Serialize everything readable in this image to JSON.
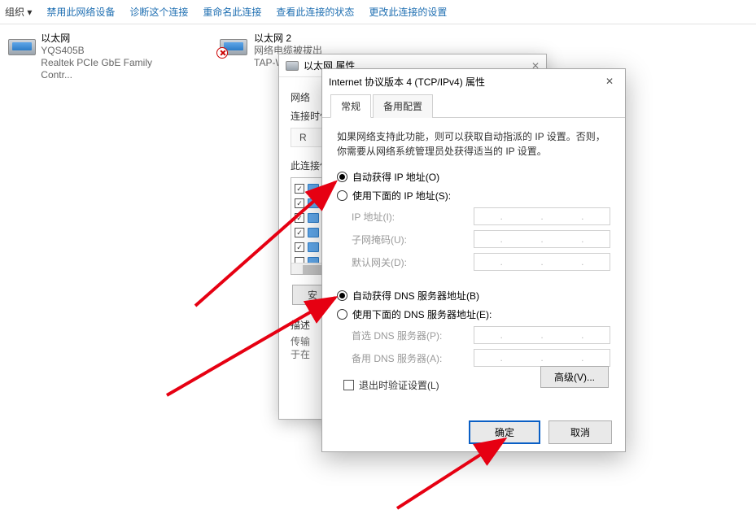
{
  "toolbar": {
    "label": "组织 ▾",
    "items": [
      "禁用此网络设备",
      "诊断这个连接",
      "重命名此连接",
      "查看此连接的状态",
      "更改此连接的设置"
    ]
  },
  "adapters": [
    {
      "name": "以太网",
      "line2": "YQS405B",
      "line3": "Realtek PCIe GbE Family Contr..."
    },
    {
      "name": "以太网 2",
      "line2": "网络电缆被拔出",
      "line3": "TAP-Windows Ada"
    }
  ],
  "back_dialog": {
    "title": "以太网 属性",
    "sec_network": "网络",
    "conn_when": "连接时使",
    "conn_val": "R",
    "items_label": "此连接使",
    "btn_install": "安",
    "desc_label": "描述",
    "desc_line1": "传输",
    "desc_line2": "于在"
  },
  "dialog": {
    "title": "Internet 协议版本 4 (TCP/IPv4) 属性",
    "tabs": {
      "general": "常规",
      "alt": "备用配置"
    },
    "intro": "如果网络支持此功能，则可以获取自动指派的 IP 设置。否则，你需要从网络系统管理员处获得适当的 IP 设置。",
    "radio_auto_ip": "自动获得 IP 地址(O)",
    "radio_manual_ip": "使用下面的 IP 地址(S):",
    "fields": {
      "ip": "IP 地址(I):",
      "mask": "子网掩码(U):",
      "gw": "默认网关(D):"
    },
    "radio_auto_dns": "自动获得 DNS 服务器地址(B)",
    "radio_manual_dns": "使用下面的 DNS 服务器地址(E):",
    "dns_fields": {
      "pref": "首选 DNS 服务器(P):",
      "alt": "备用 DNS 服务器(A):"
    },
    "chk_validate": "退出时验证设置(L)",
    "btn_advanced": "高级(V)...",
    "btn_ok": "确定",
    "btn_cancel": "取消"
  }
}
